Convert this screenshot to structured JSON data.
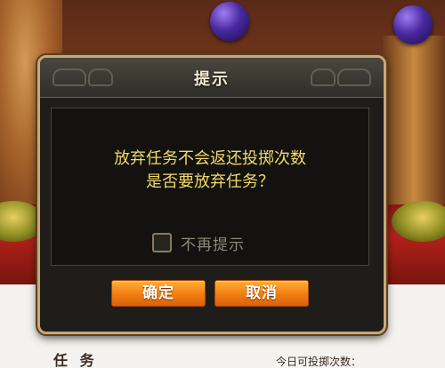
{
  "background": {
    "footer_text": "任 务",
    "footer_right_text": "今日可投掷次数："
  },
  "dialog": {
    "title": "提示",
    "message_line1": "放弃任务不会返还投掷次数",
    "message_line2": "是否要放弃任务？",
    "checkbox_label": "不再提示",
    "checkbox_checked": false,
    "confirm_label": "确定",
    "cancel_label": "取消"
  },
  "colors": {
    "message_text": "#f2d96a",
    "button_orange": "#f07c12",
    "dialog_border": "#c9a877"
  }
}
